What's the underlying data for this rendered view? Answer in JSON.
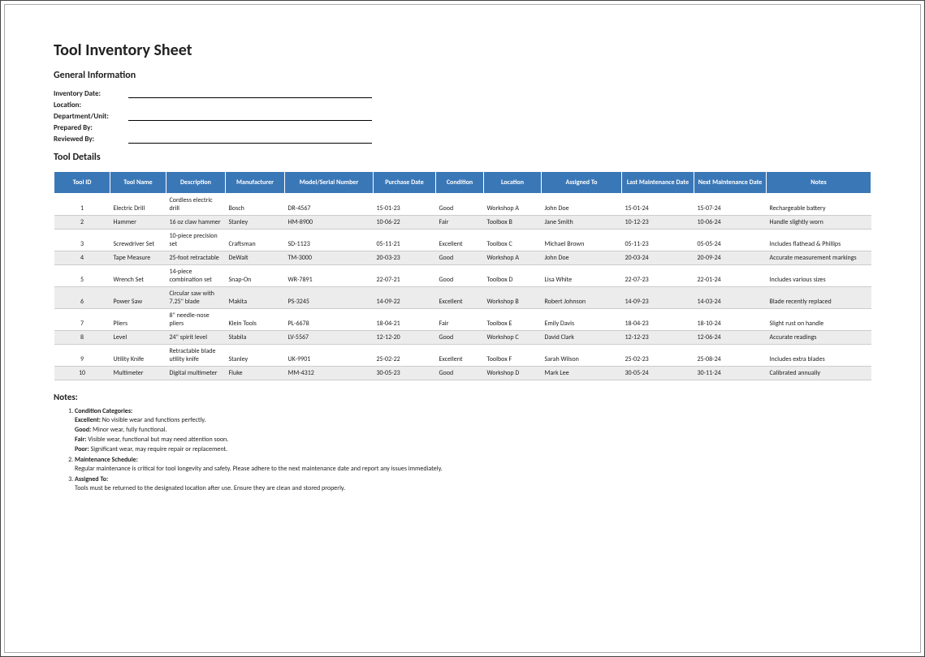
{
  "title": "Tool Inventory Sheet",
  "sections": {
    "general": "General Information",
    "details": "Tool Details",
    "notes": "Notes:"
  },
  "info": {
    "inventory_date_label": "Inventory Date:",
    "location_label": "Location:",
    "department_label": "Department/Unit:",
    "prepared_by_label": "Prepared By:",
    "reviewed_by_label": "Reviewed By:"
  },
  "headers": {
    "id": "Tool ID",
    "name": "Tool Name",
    "desc": "Description",
    "mfr": "Manufacturer",
    "model": "Model/Serial Number",
    "pdate": "Purchase Date",
    "cond": "Condition",
    "loc": "Location",
    "assign": "Assigned To",
    "last": "Last Maintenance Date",
    "next": "Next Maintenance Date",
    "notes": "Notes"
  },
  "rows": [
    {
      "id": "1",
      "name": "Electric Drill",
      "desc": "Cordless electric drill",
      "mfr": "Bosch",
      "model": "DR-4567",
      "pdate": "15-01-23",
      "cond": "Good",
      "loc": "Workshop A",
      "assign": "John Doe",
      "last": "15-01-24",
      "next": "15-07-24",
      "notes": "Rechargeable battery"
    },
    {
      "id": "2",
      "name": "Hammer",
      "desc": "16 oz claw hammer",
      "mfr": "Stanley",
      "model": "HM-8900",
      "pdate": "10-06-22",
      "cond": "Fair",
      "loc": "Toolbox B",
      "assign": "Jane Smith",
      "last": "10-12-23",
      "next": "10-06-24",
      "notes": "Handle slightly worn"
    },
    {
      "id": "3",
      "name": "Screwdriver Set",
      "desc": "10-piece precision set",
      "mfr": "Craftsman",
      "model": "SD-1123",
      "pdate": "05-11-21",
      "cond": "Excellent",
      "loc": "Toolbox C",
      "assign": "Michael Brown",
      "last": "05-11-23",
      "next": "05-05-24",
      "notes": "Includes flathead & Phillips"
    },
    {
      "id": "4",
      "name": "Tape Measure",
      "desc": "25-foot retractable",
      "mfr": "DeWalt",
      "model": "TM-3000",
      "pdate": "20-03-23",
      "cond": "Good",
      "loc": "Workshop A",
      "assign": "John Doe",
      "last": "20-03-24",
      "next": "20-09-24",
      "notes": "Accurate measurement markings"
    },
    {
      "id": "5",
      "name": "Wrench Set",
      "desc": "14-piece combination set",
      "mfr": "Snap-On",
      "model": "WR-7891",
      "pdate": "22-07-21",
      "cond": "Good",
      "loc": "Toolbox D",
      "assign": "Lisa White",
      "last": "22-07-23",
      "next": "22-01-24",
      "notes": "Includes various sizes"
    },
    {
      "id": "6",
      "name": "Power Saw",
      "desc": "Circular saw with 7.25\" blade",
      "mfr": "Makita",
      "model": "PS-3245",
      "pdate": "14-09-22",
      "cond": "Excellent",
      "loc": "Workshop B",
      "assign": "Robert Johnson",
      "last": "14-09-23",
      "next": "14-03-24",
      "notes": "Blade recently replaced"
    },
    {
      "id": "7",
      "name": "Pliers",
      "desc": "8\" needle-nose pliers",
      "mfr": "Klein Tools",
      "model": "PL-6678",
      "pdate": "18-04-21",
      "cond": "Fair",
      "loc": "Toolbox E",
      "assign": "Emily Davis",
      "last": "18-04-23",
      "next": "18-10-24",
      "notes": "Slight rust on handle"
    },
    {
      "id": "8",
      "name": "Level",
      "desc": "24\" spirit level",
      "mfr": "Stabila",
      "model": "LV-5567",
      "pdate": "12-12-20",
      "cond": "Good",
      "loc": "Workshop C",
      "assign": "David Clark",
      "last": "12-12-23",
      "next": "12-06-24",
      "notes": "Accurate readings"
    },
    {
      "id": "9",
      "name": "Utility Knife",
      "desc": "Retractable blade utility knife",
      "mfr": "Stanley",
      "model": "UK-9901",
      "pdate": "25-02-22",
      "cond": "Excellent",
      "loc": "Toolbox F",
      "assign": "Sarah Wilson",
      "last": "25-02-23",
      "next": "25-08-24",
      "notes": "Includes extra blades"
    },
    {
      "id": "10",
      "name": "Multimeter",
      "desc": "Digital multimeter",
      "mfr": "Fluke",
      "model": "MM-4312",
      "pdate": "30-05-23",
      "cond": "Good",
      "loc": "Workshop D",
      "assign": "Mark Lee",
      "last": "30-05-24",
      "next": "30-11-24",
      "notes": "Calibrated annually"
    }
  ],
  "notes": {
    "n1_title": "Condition Categories:",
    "n1_excellent_t": "Excellent:",
    "n1_excellent_d": " No visible wear and functions perfectly.",
    "n1_good_t": "Good:",
    "n1_good_d": " Minor wear, fully functional.",
    "n1_fair_t": "Fair:",
    "n1_fair_d": " Visible wear, functional but may need attention soon.",
    "n1_poor_t": "Poor:",
    "n1_poor_d": " Significant wear, may require repair or replacement.",
    "n2_title": "Maintenance Schedule:",
    "n2_body": "Regular maintenance is critical for tool longevity and safety. Please adhere to the next maintenance date and report any issues immediately.",
    "n3_title": "Assigned To:",
    "n3_body": "Tools must be returned to the designated location after use. Ensure they are clean and stored properly."
  }
}
